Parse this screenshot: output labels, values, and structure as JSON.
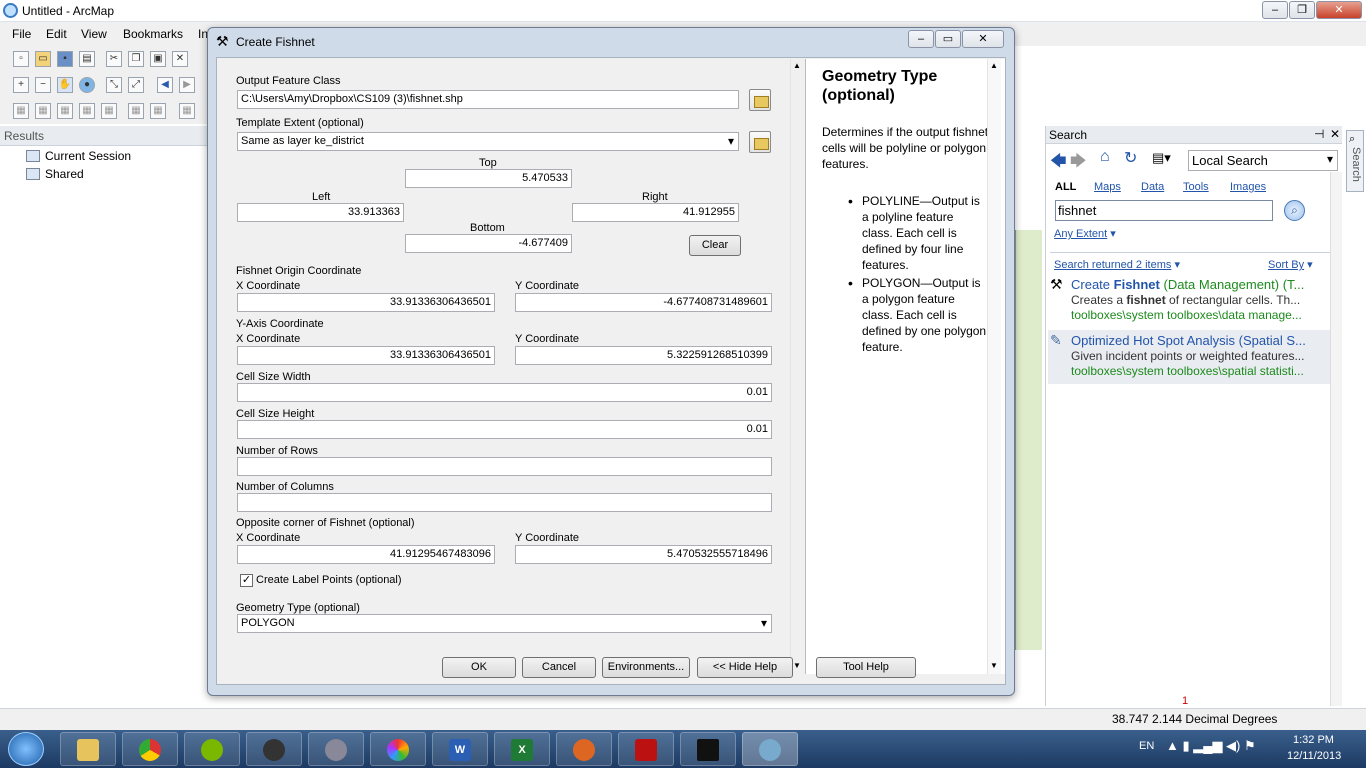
{
  "app": {
    "title": "Untitled - ArcMap",
    "menu": [
      "File",
      "Edit",
      "View",
      "Bookmarks",
      "In"
    ]
  },
  "results": {
    "header": "Results",
    "items": [
      "Current Session",
      "Shared"
    ]
  },
  "dialog": {
    "title": "Create Fishnet",
    "output_feature_class_label": "Output Feature Class",
    "output_feature_class": "C:\\Users\\Amy\\Dropbox\\CS109 (3)\\fishnet.shp",
    "template_extent_label": "Template Extent (optional)",
    "template_extent": "Same as layer ke_district",
    "extent": {
      "top_label": "Top",
      "top": "5.470533",
      "left_label": "Left",
      "left": "33.913363",
      "right_label": "Right",
      "right": "41.912955",
      "bottom_label": "Bottom",
      "bottom": "-4.677409",
      "clear": "Clear"
    },
    "origin_label": "Fishnet Origin Coordinate",
    "x_label": "X Coordinate",
    "y_label": "Y Coordinate",
    "origin_x": "33.91336306436501",
    "origin_y": "-4.677408731489601",
    "yaxis_label": "Y-Axis Coordinate",
    "yaxis_x": "33.91336306436501",
    "yaxis_y": "5.322591268510399",
    "cell_width_label": "Cell Size Width",
    "cell_width": "0.01",
    "cell_height_label": "Cell Size Height",
    "cell_height": "0.01",
    "rows_label": "Number of Rows",
    "rows": "",
    "cols_label": "Number of Columns",
    "cols": "",
    "opposite_label": "Opposite corner of Fishnet (optional)",
    "opposite_x": "41.91295467483096",
    "opposite_y": "5.470532555718496",
    "label_points": "Create Label Points (optional)",
    "label_points_checked": true,
    "geometry_label": "Geometry Type (optional)",
    "geometry": "POLYGON",
    "buttons": {
      "ok": "OK",
      "cancel": "Cancel",
      "env": "Environments...",
      "hide": "<< Hide Help",
      "toolhelp": "Tool Help"
    }
  },
  "help": {
    "title": "Geometry Type (optional)",
    "desc": "Determines if the output fishnet cells will be polyline or polygon features.",
    "bullets": [
      "POLYLINE—Output is a polyline feature class. Each cell is defined by four line features.",
      "POLYGON—Output is a polygon feature class. Each cell is defined by one polygon feature."
    ]
  },
  "search": {
    "header": "Search",
    "scope": "Local Search",
    "tabs": [
      "ALL",
      "Maps",
      "Data",
      "Tools",
      "Images"
    ],
    "query": "fishnet",
    "extent": "Any Extent",
    "returned": "Search returned 2 items",
    "sort": "Sort By",
    "side_tab": "Search",
    "results": [
      {
        "title_pre": "Create ",
        "title_bold": "Fishnet",
        "title_post": " (Data Management) (T...",
        "desc_pre": "Creates a ",
        "desc_bold": "fishnet",
        "desc_post": " of rectangular cells. Th...",
        "path": "toolboxes\\system toolboxes\\data manage..."
      },
      {
        "title_pre": "Optimized Hot Spot Analysis (Spatial S...",
        "title_bold": "",
        "title_post": "",
        "desc_pre": "Given incident points or weighted features...",
        "desc_bold": "",
        "desc_post": "",
        "path": "toolboxes\\system toolboxes\\spatial statisti..."
      }
    ]
  },
  "status": {
    "page_number": "1",
    "coords": "38.747  2.144 Decimal Degrees"
  },
  "taskbar": {
    "lang": "EN",
    "time": "1:32 PM",
    "date": "12/11/2013"
  }
}
